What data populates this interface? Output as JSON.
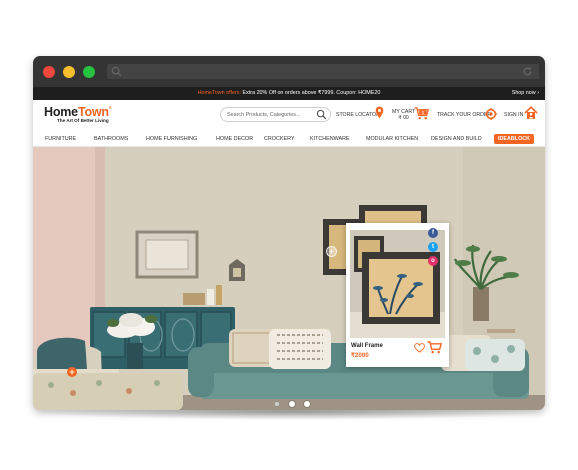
{
  "offer_bar": {
    "prefix": "HomeTown offers: ",
    "text": "Extra 20% Off on orders above ₹7999. Coupon: HOME20",
    "shop_now": "Shop now ›"
  },
  "brand": {
    "logo_home": "Home",
    "logo_town": "Town",
    "logo_reg": "®",
    "tagline": "The Art Of Better Living"
  },
  "search": {
    "placeholder": "Search Products, Categories..."
  },
  "header_links": {
    "store_locator": "STORE LOCATOR",
    "my_cart": "MY CART",
    "cart_amount": "₹ 00",
    "cart_count": "0",
    "track_order": "TRACK YOUR ORDER",
    "sign_in": "SIGN IN"
  },
  "nav": {
    "items": [
      "FURNITURE",
      "BATHROOMS",
      "HOME FURNISHING",
      "HOME DECOR",
      "CROCKERY",
      "KITCHENWARE",
      "MODULAR KITCHEN",
      "DESIGN AND BUILD"
    ],
    "highlight": "IDEABLOCK"
  },
  "product_card": {
    "name": "Wall Frame",
    "price": "₹2000"
  },
  "hotspots": {
    "symbol": "+"
  },
  "social": {
    "facebook": "f",
    "twitter": "t",
    "instagram": "o"
  },
  "colors": {
    "accent": "#f26522",
    "chrome": "#343434",
    "offer_bg": "#1e1e1e"
  },
  "carousel": {
    "slides": 3,
    "active": 2
  }
}
